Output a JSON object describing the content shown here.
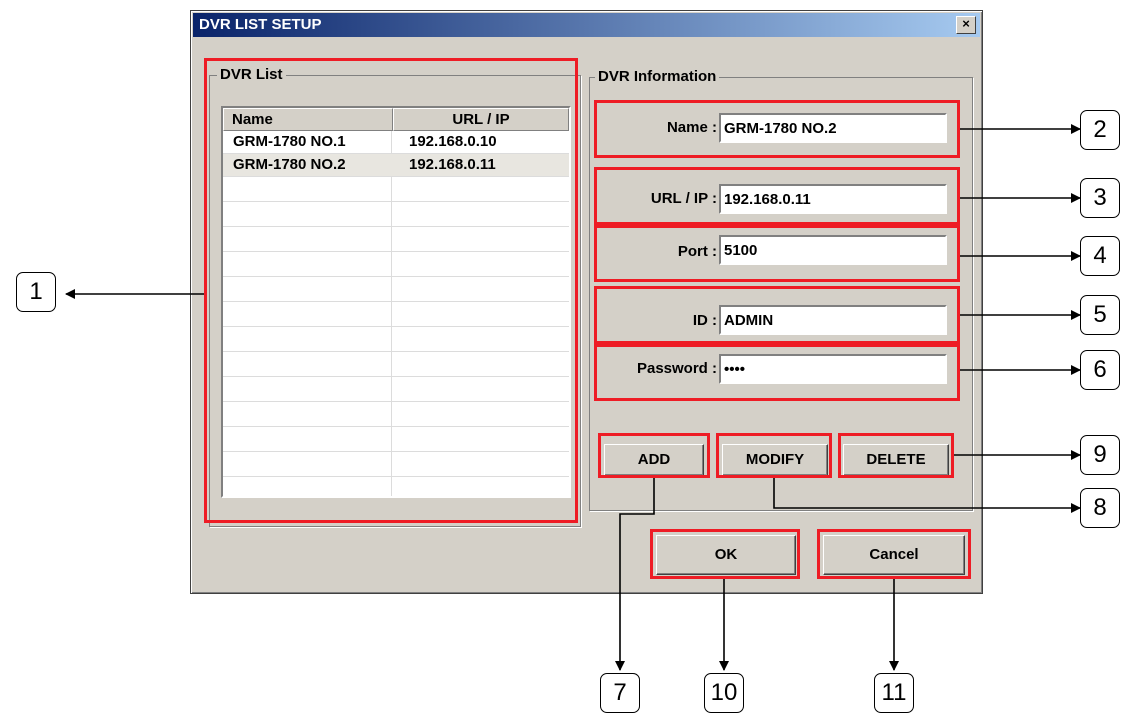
{
  "dialog": {
    "title": "DVR LIST SETUP",
    "close_glyph": "×"
  },
  "dvr_list": {
    "group_title": "DVR List",
    "columns": [
      "Name",
      "URL / IP"
    ],
    "rows": [
      {
        "name": "GRM-1780 NO.1",
        "url": "192.168.0.10",
        "selected": false
      },
      {
        "name": "GRM-1780 NO.2",
        "url": "192.168.0.11",
        "selected": true
      }
    ]
  },
  "dvr_info": {
    "group_title": "DVR Information",
    "name_label": "Name :",
    "name_value": "GRM-1780 NO.2",
    "url_label": "URL / IP :",
    "url_value": "192.168.0.11",
    "port_label": "Port :",
    "port_value": "5100",
    "id_label": "ID :",
    "id_value": "ADMIN",
    "password_label": "Password :",
    "password_value": "••••"
  },
  "buttons": {
    "add": "ADD",
    "modify": "MODIFY",
    "delete": "DELETE",
    "ok": "OK",
    "cancel": "Cancel"
  },
  "callouts": {
    "c1": "1",
    "c2": "2",
    "c3": "3",
    "c4": "4",
    "c5": "5",
    "c6": "6",
    "c7": "7",
    "c8": "8",
    "c9": "9",
    "c10": "10",
    "c11": "11"
  },
  "colors": {
    "highlight": "#ee1c25",
    "dialog_bg": "#d4d0c8",
    "title_start": "#0a246a",
    "title_end": "#a6caf0"
  }
}
